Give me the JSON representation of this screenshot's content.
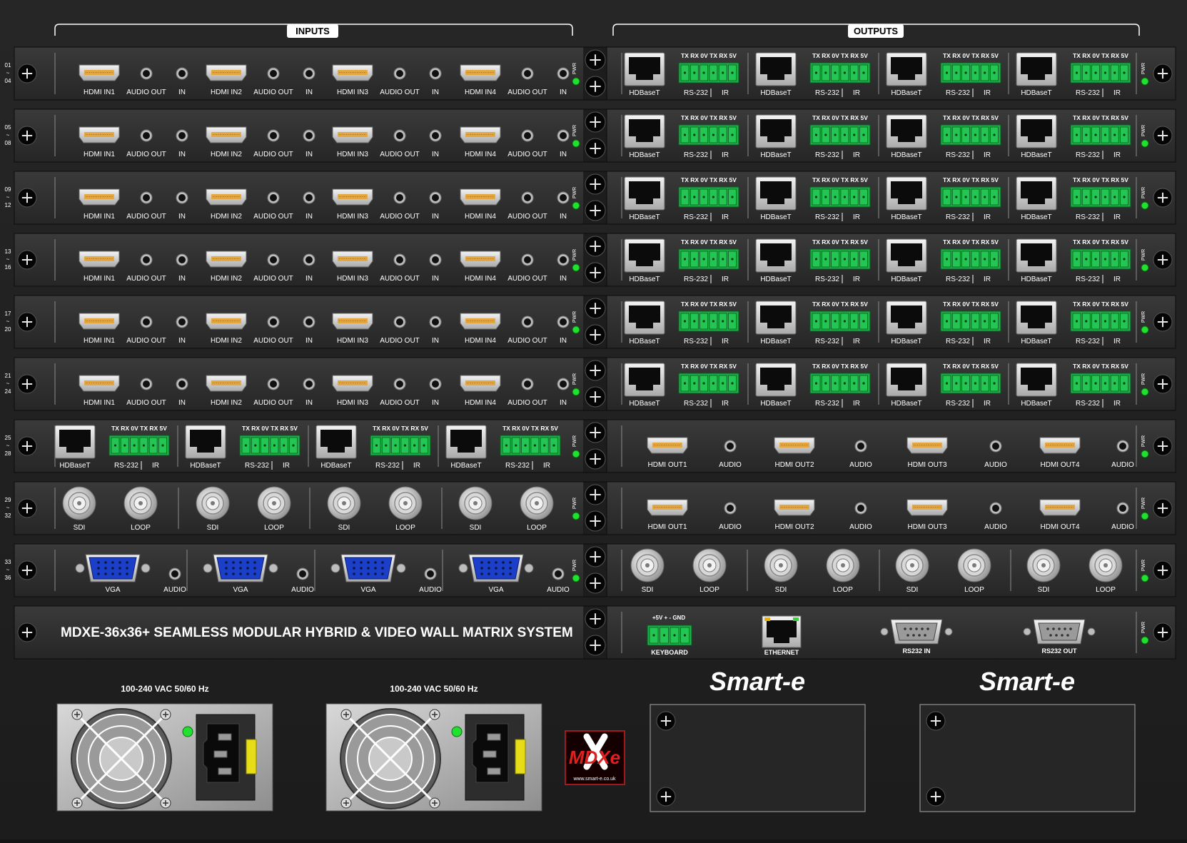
{
  "header": {
    "inputs_label": "INPUTS",
    "outputs_label": "OUTPUTS"
  },
  "colors": {
    "panel": "#2e2e2e",
    "pwr_led": "#22e030",
    "terminal": "#1fae45",
    "vga": "#1b3fc9",
    "gold": "#e3a640",
    "warning": "#e6dc18"
  },
  "labels": {
    "hdmi_in": [
      "HDMI IN1",
      "HDMI IN2",
      "HDMI IN3",
      "HDMI IN4"
    ],
    "audio_out": "AUDIO OUT",
    "ir_in": "IN",
    "hdbaset": "HDBaseT",
    "term_header": "TX RX 0V TX RX 5V",
    "rs232": "RS-232",
    "ir": "IR",
    "pwr": "PWR",
    "hdmi_out": [
      "HDMI OUT1",
      "HDMI OUT2",
      "HDMI OUT3",
      "HDMI OUT4"
    ],
    "audio": "AUDIO",
    "sdi": "SDI",
    "loop": "LOOP",
    "vga": "VGA"
  },
  "slots": [
    {
      "top": "01",
      "bottom": "04",
      "input": "hdmi",
      "output": "hdbaset"
    },
    {
      "top": "05",
      "bottom": "08",
      "input": "hdmi",
      "output": "hdbaset"
    },
    {
      "top": "09",
      "bottom": "12",
      "input": "hdmi",
      "output": "hdbaset"
    },
    {
      "top": "13",
      "bottom": "16",
      "input": "hdmi",
      "output": "hdbaset"
    },
    {
      "top": "17",
      "bottom": "20",
      "input": "hdmi",
      "output": "hdbaset"
    },
    {
      "top": "21",
      "bottom": "24",
      "input": "hdmi",
      "output": "hdbaset"
    },
    {
      "top": "25",
      "bottom": "28",
      "input": "hdbaset",
      "output": "hdmi"
    },
    {
      "top": "29",
      "bottom": "32",
      "input": "sdi",
      "output": "hdmi"
    },
    {
      "top": "33",
      "bottom": "36",
      "input": "vga",
      "output": "sdi"
    }
  ],
  "control": {
    "title": "MDXE-36x36+ SEAMLESS MODULAR HYBRID & VIDEO WALL MATRIX SYSTEM",
    "keyboard_pins": "+5V  +  -  GND",
    "keyboard": "KEYBOARD",
    "ethernet": "ETHERNET",
    "rs232_in": "RS232 IN",
    "rs232_out": "RS232 OUT"
  },
  "power": {
    "psu1_label": "100-240 VAC 50/60 Hz",
    "psu2_label": "100-240 VAC 50/60 Hz"
  },
  "logo": {
    "url": "www.smart-e.co.uk"
  },
  "brand": {
    "name1": "Smart-e",
    "name2": "Smart-e"
  }
}
